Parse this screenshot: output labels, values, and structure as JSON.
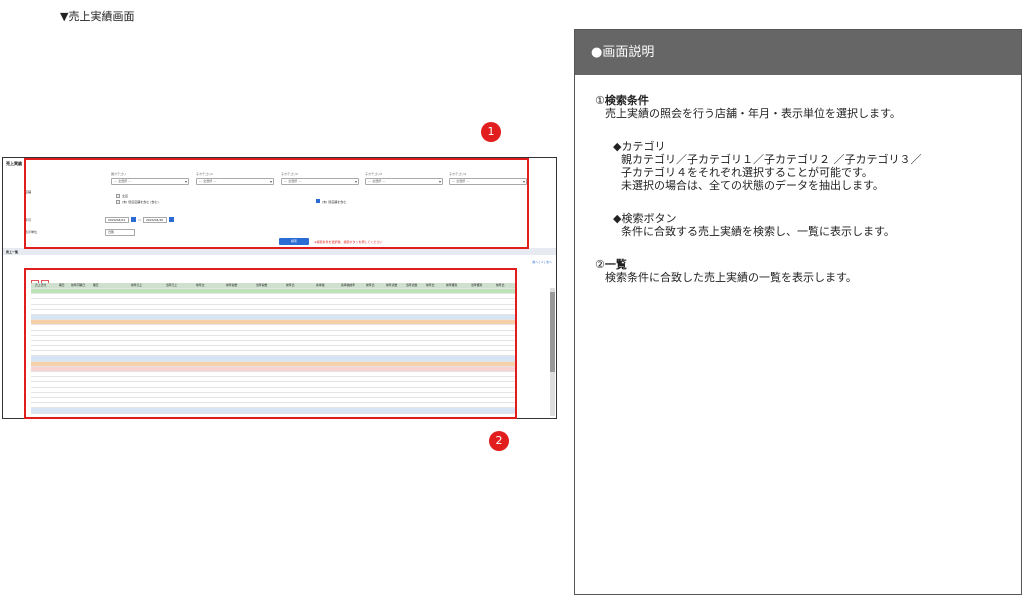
{
  "heading": "▼売上実績画面",
  "screenshot": {
    "title": "売上実績",
    "cat_row_label": "店舗",
    "categories": [
      {
        "label": "親カテゴリ",
        "value": "--- 全選択 ---"
      },
      {
        "label": "子カテゴリ1",
        "value": "--- 全選択 ---"
      },
      {
        "label": "子カテゴリ2",
        "value": "--- 全選択 ---"
      },
      {
        "label": "子カテゴリ3",
        "value": "--- 全選択 ---"
      },
      {
        "label": "子カテゴリ4",
        "value": "--- 全選択 ---"
      }
    ],
    "chk_all": "全店",
    "chk_hidden": "(未) 閉店店舗を含む (含む)",
    "chk_right": "(未) 閉店舗を含む",
    "date_label": "年月",
    "date_from": "2024/04/01",
    "date_sep": "～",
    "date_to": "2024/04/30",
    "unit_label": "表示単位",
    "unit_value": "日別",
    "search_label": "検索",
    "note": "※検索条件を選択後、検索ボタンを押してください",
    "list_title": "売上一覧",
    "pager": "前へ | 1 | 次へ",
    "grid_headers": [
      "売上日付",
      "曜日",
      "前年同曜日",
      "曜日",
      "前年売上",
      "当年売上",
      "前年比",
      "前年客数",
      "当年客数",
      "前年比",
      "客単価",
      "客単価前年",
      "前年比",
      "前年点数",
      "当年点数",
      "前年比",
      "前年粗利",
      "当年粗利",
      "前年比"
    ]
  },
  "badges": [
    "1",
    "2"
  ],
  "panel": {
    "title": "●画面説明",
    "s1_num": "①",
    "s1_title": "検索条件",
    "s1_desc": "売上実績の照会を行う店舗・年月・表示単位を選択します。",
    "cat_title": "◆カテゴリ",
    "cat_l1": "親カテゴリ／子カテゴリ１／子カテゴリ２ ／子カテゴリ３／",
    "cat_l2": "子カテゴリ４をそれぞれ選択することが可能です。",
    "cat_l3": "未選択の場合は、全ての状態のデータを抽出します。",
    "btn_title": "◆検索ボタン",
    "btn_l1": "条件に合致する売上実績を検索し、一覧に表示します。",
    "s2_num": "②",
    "s2_title": "一覧",
    "s2_desc": "検索条件に合致した売上実績の一覧を表示します。"
  }
}
